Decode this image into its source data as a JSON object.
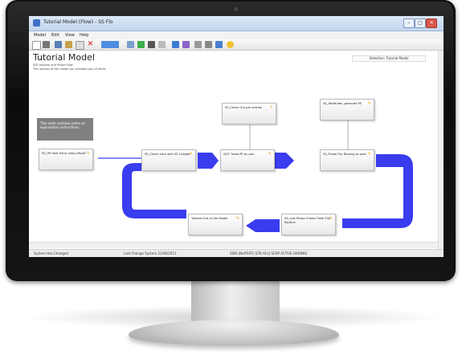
{
  "window": {
    "title": "Tutorial Model (Flow) - SS Flo"
  },
  "menu": [
    "Model",
    "Edit",
    "View",
    "Help"
  ],
  "canvas": {
    "title": "Tutorial Model",
    "subtitle_line1": "SSE process and Phase Flow",
    "subtitle_line2": "This section of the model can simulate any of items",
    "selection_label": "Selection: Tutorial Model",
    "note_text": "This node contains notes an explanation instructions."
  },
  "nodes": [
    {
      "id": "n1",
      "label": "SS_HP Host Entry (step) Model"
    },
    {
      "id": "n2",
      "label": "SS_Check Intra with SS Linkage"
    },
    {
      "id": "n3",
      "label": "SS_Check Out per entries"
    },
    {
      "id": "n4",
      "label": "SS/T Trade PE to user"
    },
    {
      "id": "n5",
      "label": "SS_Attributes, generate PE"
    },
    {
      "id": "n6",
      "label": "SS_Phase Flip Routing to start"
    },
    {
      "id": "n7",
      "label": "SS_Last Phase Create Flash Flip Routine"
    },
    {
      "id": "n8",
      "label": "Tutorial End of Life Model"
    }
  ],
  "status": {
    "left": "System Has Changed",
    "mid": "Last Change System 21/06/2011",
    "right": "SSID (No/FEAT) [LT8 ACL] SUSP ACTIVE (HIDING)"
  },
  "colors": {
    "flow_blue": "#3a3cf0",
    "flow_light": "#6f73ff"
  }
}
